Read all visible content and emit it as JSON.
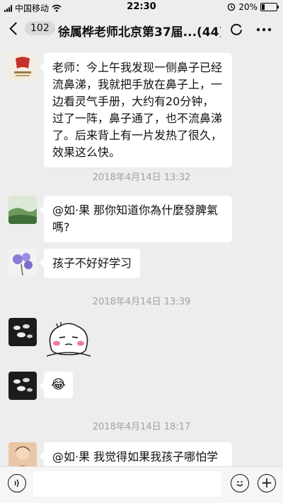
{
  "status_bar": {
    "carrier": "中国移动",
    "time": "22:30",
    "battery_percent": "20%",
    "battery_level": 0.2
  },
  "nav": {
    "back_count": "102",
    "title": "徐属桦老师北京第37届...",
    "member_count": "(44)"
  },
  "messages": [
    {
      "avatar": "book-logo-avatar",
      "lines": [
        "老师：今上午我发现一侧鼻子已经",
        "流鼻涕，我就把手放在鼻子上，一",
        "边看灵气手册，大约有20分钟，",
        "过了一阵，鼻子通了，也不流鼻涕",
        "了。后来背上有一片发热了很久，",
        "效果这么快。"
      ]
    },
    {
      "avatar": "landscape-avatar",
      "lines": [
        "@如·果 那你知道你為什麼發脾氣",
        "嗎?"
      ]
    },
    {
      "avatar": "purple-flower-avatar",
      "lines": [
        "孩子不好好学习"
      ]
    },
    {
      "avatar": "dark-cups-avatar",
      "sticker": "blushing-bun-sticker"
    },
    {
      "avatar": "dark-cups-avatar",
      "emoji": "😂"
    },
    {
      "avatar": "portrait-avatar",
      "lines": [
        "@如·果 我觉得如果我孩子哪怕学"
      ]
    }
  ],
  "timestamps": [
    "2018年4月14日 13:32",
    "2018年4月14日 13:39",
    "2018年4月14日 18:17"
  ],
  "input_bar": {
    "voice_icon": "voice-icon",
    "emoji_icon": "emoji-icon",
    "plus_icon": "plus-icon",
    "plus_glyph": "+"
  }
}
